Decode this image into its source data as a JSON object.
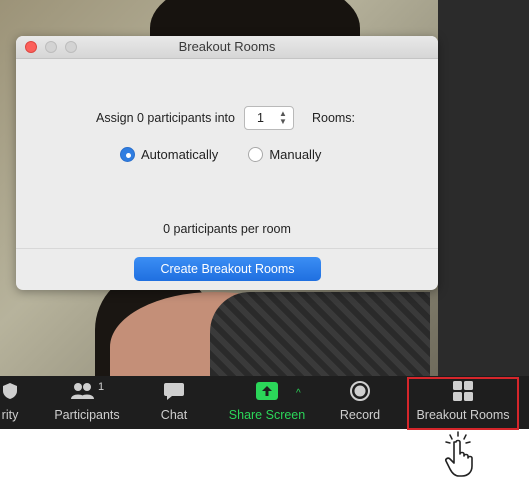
{
  "dialog": {
    "title": "Breakout Rooms",
    "assign_prefix": "Assign 0 participants into",
    "rooms_value": "1",
    "rooms_suffix": "Rooms:",
    "radio_options": [
      {
        "label": "Automatically",
        "selected": true
      },
      {
        "label": "Manually",
        "selected": false
      }
    ],
    "per_room_text": "0 participants per room",
    "create_button": "Create Breakout Rooms"
  },
  "toolbar": {
    "security_label": "rity",
    "participants_label": "Participants",
    "participants_count": "1",
    "chat_label": "Chat",
    "share_label": "Share Screen",
    "record_label": "Record",
    "breakout_label": "Breakout Rooms"
  },
  "colors": {
    "accent_blue": "#2f7de1",
    "share_green": "#2bd659",
    "highlight_red": "#d6262b",
    "toolbar_bg": "#1e1e1e"
  },
  "icons": {
    "security": "shield-icon",
    "participants": "participants-icon",
    "chat": "chat-bubble-icon",
    "share": "share-screen-arrow-icon",
    "record": "record-circle-icon",
    "breakout": "breakout-grid-icon",
    "cursor": "hand-pointer-icon"
  }
}
